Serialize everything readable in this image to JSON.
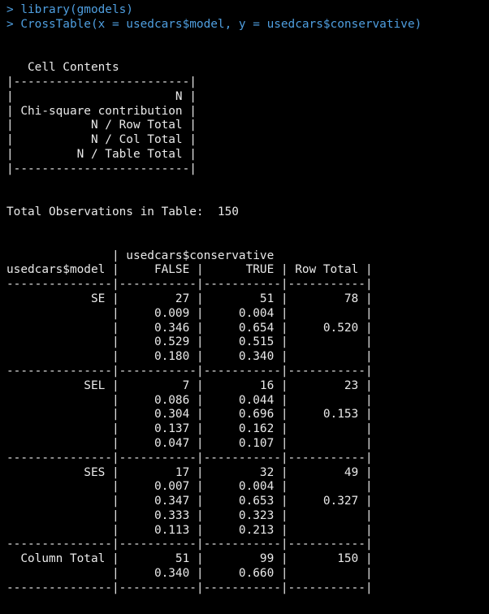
{
  "console": {
    "prompt": "> ",
    "commands": [
      "library(gmodels)",
      "CrossTable(x = usedcars$model, y = usedcars$conservative)"
    ],
    "colors": {
      "background": "#000000",
      "command": "#4f9fe0",
      "output": "#e9e9e9"
    }
  },
  "cell_contents": [
    "   Cell Contents",
    "|-------------------------|",
    "|                       N |",
    "| Chi-square contribution |",
    "|           N / Row Total |",
    "|           N / Col Total |",
    "|         N / Table Total |",
    "|-------------------------|"
  ],
  "total_observations": "Total Observations in Table:  150",
  "crosstab": [
    "               | usedcars$conservative ",
    "usedcars$model |     FALSE |      TRUE | Row Total | ",
    "---------------|-----------|-----------|-----------|",
    "            SE |        27 |        51 |        78 | ",
    "               |     0.009 |     0.004 |           | ",
    "               |     0.346 |     0.654 |     0.520 | ",
    "               |     0.529 |     0.515 |           | ",
    "               |     0.180 |     0.340 |           | ",
    "---------------|-----------|-----------|-----------|",
    "           SEL |         7 |        16 |        23 | ",
    "               |     0.086 |     0.044 |           | ",
    "               |     0.304 |     0.696 |     0.153 | ",
    "               |     0.137 |     0.162 |           | ",
    "               |     0.047 |     0.107 |           | ",
    "---------------|-----------|-----------|-----------|",
    "           SES |        17 |        32 |        49 | ",
    "               |     0.007 |     0.004 |           | ",
    "               |     0.347 |     0.653 |     0.327 | ",
    "               |     0.333 |     0.323 |           | ",
    "               |     0.113 |     0.213 |           | ",
    "---------------|-----------|-----------|-----------|",
    "  Column Total |        51 |        99 |       150 | ",
    "               |     0.340 |     0.660 |           | ",
    "---------------|-----------|-----------|-----------|"
  ]
}
